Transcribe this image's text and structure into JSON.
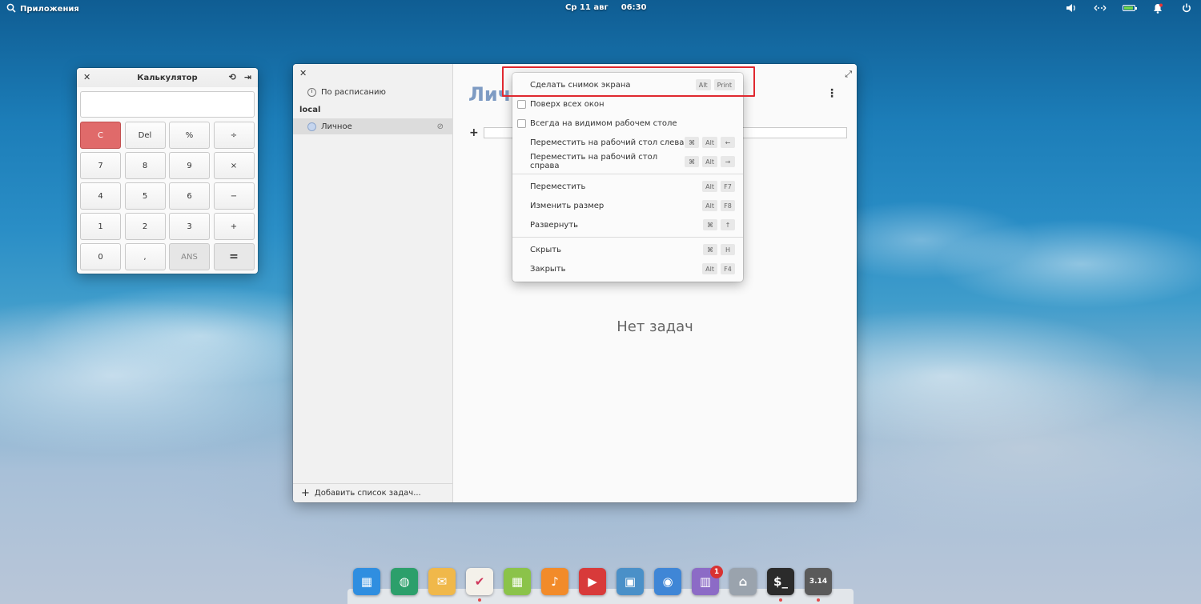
{
  "top_panel": {
    "apps_label": "Приложения",
    "date": "Ср 11 авг",
    "time": "06:30"
  },
  "calculator": {
    "title": "Калькулятор",
    "display_value": "",
    "keys": [
      {
        "label": "C",
        "style": "danger"
      },
      {
        "label": "Del",
        "style": "normal"
      },
      {
        "label": "%",
        "style": "normal"
      },
      {
        "label": "÷",
        "style": "normal"
      },
      {
        "label": "7",
        "style": "normal"
      },
      {
        "label": "8",
        "style": "normal"
      },
      {
        "label": "9",
        "style": "normal"
      },
      {
        "label": "×",
        "style": "normal"
      },
      {
        "label": "4",
        "style": "normal"
      },
      {
        "label": "5",
        "style": "normal"
      },
      {
        "label": "6",
        "style": "normal"
      },
      {
        "label": "−",
        "style": "normal"
      },
      {
        "label": "1",
        "style": "normal"
      },
      {
        "label": "2",
        "style": "normal"
      },
      {
        "label": "3",
        "style": "normal"
      },
      {
        "label": "+",
        "style": "normal"
      },
      {
        "label": "0",
        "style": "normal"
      },
      {
        "label": ",",
        "style": "normal"
      },
      {
        "label": "ANS",
        "style": "muted"
      },
      {
        "label": "=",
        "style": "equals"
      }
    ]
  },
  "tasks": {
    "sidebar": {
      "scheduled_label": "По расписанию",
      "section_heading": "local",
      "list_label": "Личное",
      "add_list_label": "Добавить список задач..."
    },
    "main": {
      "list_title": "Личн",
      "empty_text": "Нет задач"
    }
  },
  "context_menu": {
    "items": [
      {
        "label": "Сделать снимок экрана",
        "keys": [
          "Alt",
          "Print"
        ],
        "checkbox": false,
        "sep_after": false
      },
      {
        "label": "Поверх всех окон",
        "keys": [],
        "checkbox": true,
        "sep_after": false
      },
      {
        "label": "Всегда на видимом рабочем столе",
        "keys": [],
        "checkbox": true,
        "sep_after": false
      },
      {
        "label": "Переместить на рабочий стол слева",
        "keys": [
          "⌘",
          "Alt",
          "←"
        ],
        "checkbox": false,
        "sep_after": false
      },
      {
        "label": "Переместить на рабочий стол справа",
        "keys": [
          "⌘",
          "Alt",
          "→"
        ],
        "checkbox": false,
        "sep_after": true
      },
      {
        "label": "Переместить",
        "keys": [
          "Alt",
          "F7"
        ],
        "checkbox": false,
        "sep_after": false
      },
      {
        "label": "Изменить размер",
        "keys": [
          "Alt",
          "F8"
        ],
        "checkbox": false,
        "sep_after": false
      },
      {
        "label": "Развернуть",
        "keys": [
          "⌘",
          "↑"
        ],
        "checkbox": false,
        "sep_after": true
      },
      {
        "label": "Скрыть",
        "keys": [
          "⌘",
          "H"
        ],
        "checkbox": false,
        "sep_after": false
      },
      {
        "label": "Закрыть",
        "keys": [
          "Alt",
          "F4"
        ],
        "checkbox": false,
        "sep_after": false
      }
    ],
    "highlight_color": "#e0282f"
  },
  "dock": {
    "items": [
      {
        "name": "multitasking-view-icon",
        "glyph": "▦",
        "color": "#2f8ee0",
        "badge": "",
        "running": false
      },
      {
        "name": "web-browser-icon",
        "glyph": "◍",
        "color": "#2c9f6b",
        "badge": "",
        "running": false
      },
      {
        "name": "mail-icon",
        "glyph": "✉",
        "color": "#f0b84a",
        "badge": "",
        "running": false
      },
      {
        "name": "tasks-icon",
        "glyph": "✔",
        "color": "#f4f1ea",
        "badge": "",
        "running": true
      },
      {
        "name": "calendar-icon",
        "glyph": "▦",
        "color": "#8bc34a",
        "badge": "",
        "running": false
      },
      {
        "name": "music-icon",
        "glyph": "♪",
        "color": "#f28b2a",
        "badge": "",
        "running": false
      },
      {
        "name": "videos-icon",
        "glyph": "▶",
        "color": "#d83a3a",
        "badge": "",
        "running": false
      },
      {
        "name": "photos-icon",
        "glyph": "▣",
        "color": "#4a90c8",
        "badge": "",
        "running": false
      },
      {
        "name": "settings-icon",
        "glyph": "◉",
        "color": "#3f86d6",
        "badge": "",
        "running": false
      },
      {
        "name": "appcenter-icon",
        "glyph": "▥",
        "color": "#8c6bc6",
        "badge": "1",
        "running": false
      },
      {
        "name": "files-icon",
        "glyph": "⌂",
        "color": "#9aa3ad",
        "badge": "",
        "running": false
      },
      {
        "name": "terminal-icon",
        "glyph": "$_",
        "color": "#2b2b2b",
        "badge": "",
        "running": true
      },
      {
        "name": "calculator-icon",
        "glyph": "3.14",
        "color": "#5a5a5a",
        "badge": "",
        "running": true
      }
    ]
  }
}
